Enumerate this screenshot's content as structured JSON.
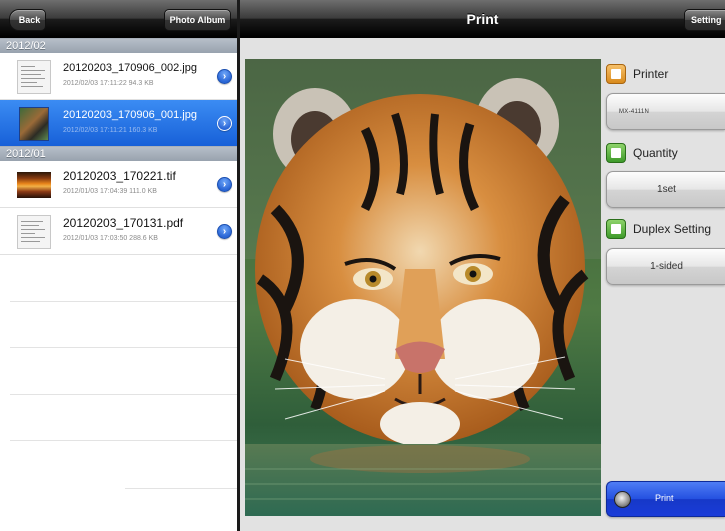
{
  "left_nav": {
    "back_label": "Back",
    "album_label": "Photo Album"
  },
  "sections": [
    {
      "header": "2012/02",
      "files": [
        {
          "name": "20120203_170906_002.jpg",
          "meta": "2012/02/03 17:11:22   94.3 KB",
          "thumb": "document-thumbnail",
          "selected": false
        },
        {
          "name": "20120203_170906_001.jpg",
          "meta": "2012/02/03 17:11:21   160.3 KB",
          "thumb": "tiger-thumbnail",
          "selected": true
        }
      ]
    },
    {
      "header": "2012/01",
      "files": [
        {
          "name": "20120203_170221.tif",
          "meta": "2012/01/03 17:04:39   111.0 KB",
          "thumb": "sunset-thumbnail",
          "selected": false
        },
        {
          "name": "20120203_170131.pdf",
          "meta": "2012/01/03 17:03:50   288.6 KB",
          "thumb": "document-thumbnail",
          "selected": false
        }
      ]
    }
  ],
  "right_nav": {
    "title": "Print",
    "setting_label": "Setting"
  },
  "preview": {
    "subject": "tiger-photo"
  },
  "options": {
    "printer": {
      "label": "Printer",
      "value": "MX-4111N",
      "icon": "printer-icon"
    },
    "quantity": {
      "label": "Quantity",
      "value": "1set",
      "icon": "quantity-icon"
    },
    "duplex": {
      "label": "Duplex Setting",
      "value": "1-sided",
      "icon": "duplex-icon"
    }
  },
  "print_button": {
    "label": "Print",
    "icon": "print-icon"
  },
  "colors": {
    "selection": "#1f6ee6",
    "section_header": "#a4aeba",
    "print_button": "#2450e0",
    "disclosure": "#2a66d6"
  }
}
